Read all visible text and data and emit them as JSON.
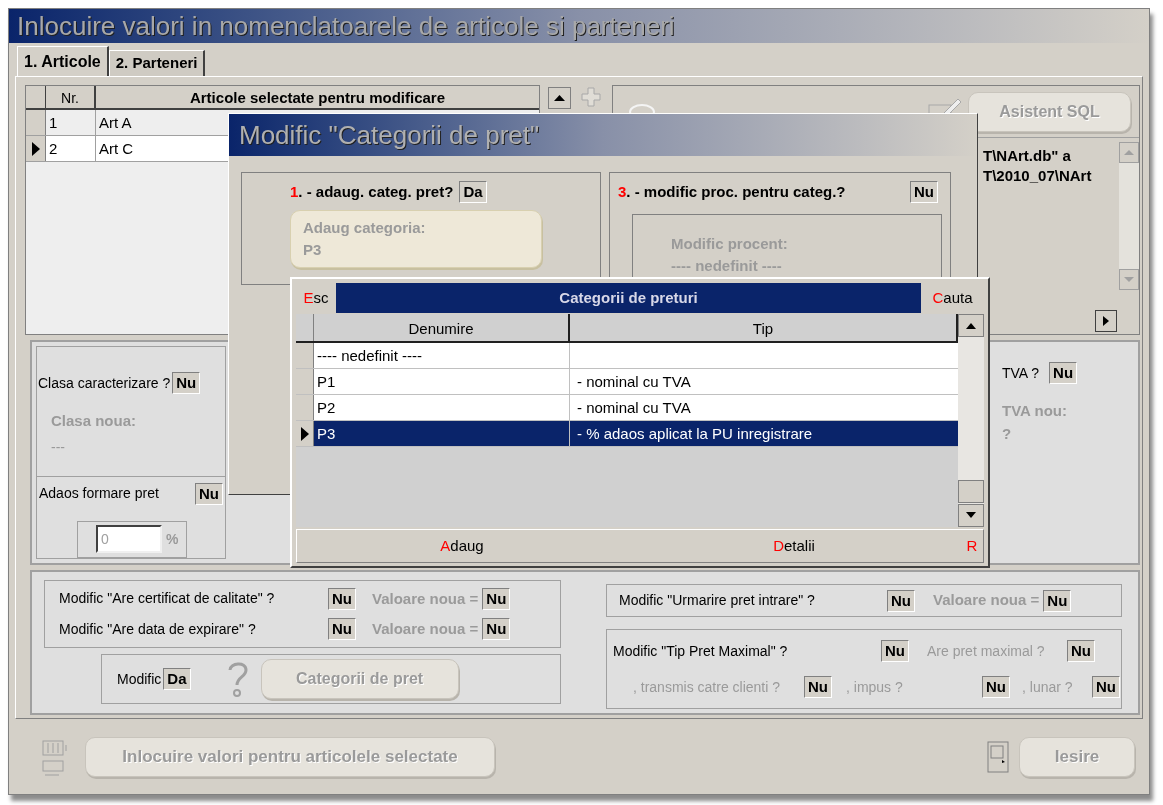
{
  "window": {
    "title": "Inlocuire valori in nomenclatoarele de articole si parteneri"
  },
  "tabs": [
    {
      "label": "1. Articole",
      "selected": true
    },
    {
      "label": "2. Parteneri",
      "selected": false
    }
  ],
  "articles_grid": {
    "columns": [
      "Nr.",
      "Articole selectate pentru modificare"
    ],
    "rows": [
      {
        "nr": "1",
        "name": "Art A",
        "selected": false
      },
      {
        "nr": "2",
        "name": "Art C",
        "selected": true
      }
    ]
  },
  "sql_panel": {
    "button": {
      "label": "Asistent SQL",
      "disabled": true
    },
    "lines": [
      "T\\NArt.db\" a",
      "T\\2010_07\\NArt"
    ]
  },
  "class_panel": {
    "question": "Clasa caracterizare ?",
    "value": "Nu",
    "new_label": "Clasa noua:",
    "new_value": "---",
    "markup_label": "Adaos formare pret",
    "markup_value": "Nu",
    "percent_value": "0",
    "percent_unit": "%"
  },
  "vat_panel": {
    "question": "TVA ?",
    "value": "Nu",
    "new_label": "TVA nou:",
    "new_value": "?"
  },
  "flags": [
    {
      "question": "Modific \"Are certificat de calitate\" ?",
      "value": "Nu",
      "new_label": "Valoare noua =",
      "new_value": "Nu"
    },
    {
      "question": "Modific \"Are data de expirare\" ?",
      "value": "Nu",
      "new_label": "Valoare noua =",
      "new_value": "Nu"
    }
  ],
  "price_categories": {
    "label": "Modific",
    "value": "Da",
    "button": {
      "label": "Categorii de pret",
      "disabled": true
    }
  },
  "tracking": {
    "question": "Modific \"Urmarire pret intrare\" ?",
    "value": "Nu",
    "new_label": "Valoare noua =",
    "new_value": "Nu"
  },
  "max_price": {
    "question": "Modific \"Tip Pret Maximal\" ?",
    "value": "Nu",
    "options": [
      {
        "label": "Are pret maximal ?",
        "value": "Nu"
      },
      {
        "label": ", transmis catre clienti ?",
        "value": "Nu"
      },
      {
        "label": ", impus ?",
        "value": "Nu"
      },
      {
        "label": ", lunar ?",
        "value": "Nu"
      }
    ]
  },
  "footer": {
    "replace_button": {
      "label": "Inlocuire valori pentru articolele selectate",
      "disabled": true
    },
    "exit_button": {
      "label": "Iesire",
      "disabled": true
    }
  },
  "category_dialog": {
    "title": "Modific \"Categorii de pret\"",
    "step1": {
      "number": "1",
      "question": ". - adaug. categ. pret?",
      "value": "Da",
      "add_label": "Adaug categoria:",
      "add_value": "P3"
    },
    "step3": {
      "number": "3",
      "question": ". - modific proc. pentru categ.?",
      "value": "Nu",
      "percent_label": "Modific procent:",
      "percent_value": "---- nedefinit ----"
    }
  },
  "picker": {
    "title": "Categorii de preturi",
    "esc": {
      "key": "E",
      "rest": "sc"
    },
    "search": {
      "key": "C",
      "rest": "auta"
    },
    "columns": [
      "Denumire",
      "Tip"
    ],
    "rows": [
      {
        "name": "---- nedefinit ----",
        "selected": false
      },
      {
        "name": "P1",
        "type": "- nominal cu TVA",
        "selected": false
      },
      {
        "name": "P2",
        "type": "- nominal cu TVA",
        "selected": false
      },
      {
        "name": "P3",
        "type": "- % adaos aplicat la PU inregistrare",
        "selected": true
      }
    ],
    "buttons": [
      {
        "key": "A",
        "rest": "daug"
      },
      {
        "key": "D",
        "rest": "etalii"
      },
      {
        "key": "R"
      }
    ]
  }
}
